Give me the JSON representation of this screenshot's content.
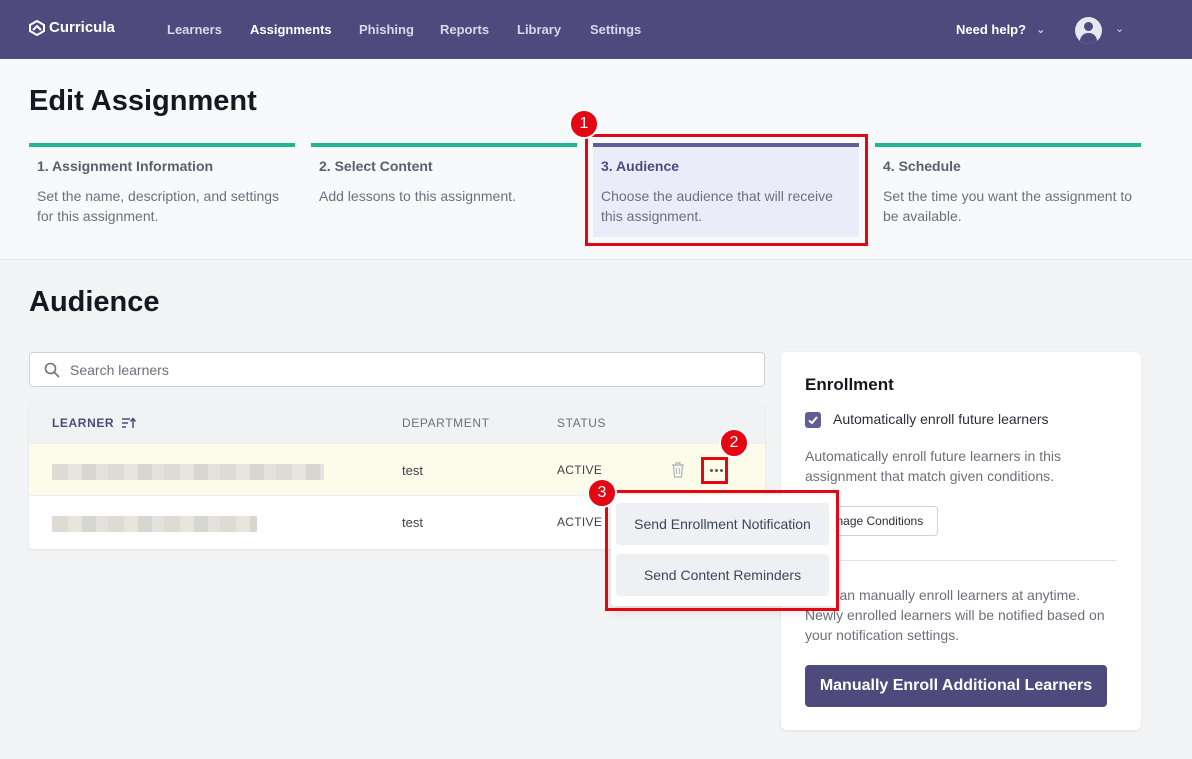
{
  "nav": {
    "logo": "Curricula",
    "links": [
      "Learners",
      "Assignments",
      "Phishing",
      "Reports",
      "Library",
      "Settings"
    ],
    "active": "Assignments",
    "help": "Need help?"
  },
  "page": {
    "title": "Edit Assignment"
  },
  "steps": [
    {
      "title": "1. Assignment Information",
      "desc": "Set the name, description, and settings for this assignment."
    },
    {
      "title": "2. Select Content",
      "desc": "Add lessons to this assignment."
    },
    {
      "title": "3. Audience",
      "desc": "Choose the audience that will receive this assignment."
    },
    {
      "title": "4. Schedule",
      "desc": "Set the time you want the assignment to be available."
    }
  ],
  "audience": {
    "title": "Audience",
    "search_placeholder": "Search learners",
    "columns": {
      "learner": "LEARNER",
      "department": "DEPARTMENT",
      "status": "STATUS"
    },
    "rows": [
      {
        "department": "test",
        "status": "ACTIVE"
      },
      {
        "department": "test",
        "status": "ACTIVE"
      }
    ]
  },
  "menu": {
    "items": [
      "Send Enrollment Notification",
      "Send Content Reminders"
    ]
  },
  "enrollment": {
    "title": "Enrollment",
    "auto_label": "Automatically enroll future learners",
    "auto_desc": "Automatically enroll future learners in this assignment that match given conditions.",
    "manage_button": "Manage Conditions",
    "manual_desc": "You can manually enroll learners at anytime. Newly enrolled learners will be notified based on your notification settings.",
    "enroll_button": "Manually Enroll Additional Learners"
  },
  "annotations": [
    "1",
    "2",
    "3"
  ],
  "colors": {
    "brand": "#4f4a7e",
    "step_complete": "#1fb691",
    "annotation": "#e30613"
  }
}
